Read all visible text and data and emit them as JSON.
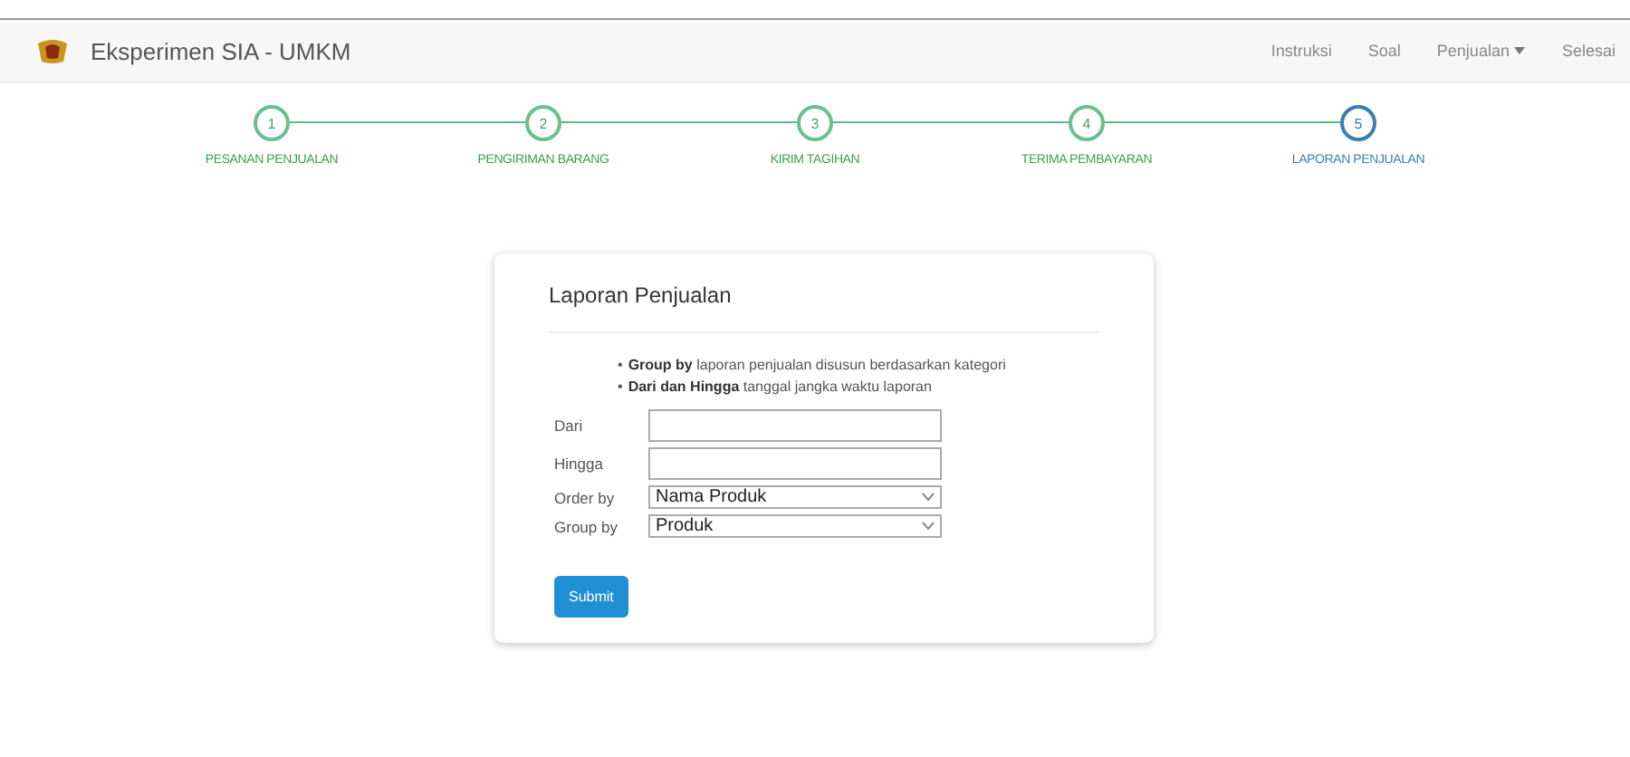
{
  "navbar": {
    "brand": "Eksperimen SIA - UMKM",
    "items": [
      {
        "label": "Instruksi",
        "kind": "link"
      },
      {
        "label": "Soal",
        "kind": "link"
      },
      {
        "label": "Penjualan",
        "kind": "dropdown"
      },
      {
        "label": "Selesai",
        "kind": "link"
      }
    ]
  },
  "steps": [
    {
      "number": "1",
      "label": "PESANAN PENJUALAN",
      "current": false
    },
    {
      "number": "2",
      "label": "PENGIRIMAN BARANG",
      "current": false
    },
    {
      "number": "3",
      "label": "KIRIM TAGIHAN",
      "current": false
    },
    {
      "number": "4",
      "label": "TERIMA PEMBAYARAN",
      "current": false
    },
    {
      "number": "5",
      "label": "LAPORAN PENJUALAN",
      "current": true
    }
  ],
  "card": {
    "title": "Laporan Penjualan",
    "notes": [
      {
        "bullet": "•",
        "text": "**Group by** laporan penjualan disusun berdasarkan kategori"
      },
      {
        "bullet": "•",
        "text": "**Dari dan Hingga** tanggal jangka waktu laporan"
      }
    ],
    "fields": [
      {
        "label": "Dari",
        "kind": "text"
      },
      {
        "label": "Hingga",
        "kind": "text"
      },
      {
        "label": "Order by",
        "kind": "select",
        "value": "Nama Produk"
      },
      {
        "label": "Group by",
        "kind": "select",
        "value": "Produk"
      }
    ],
    "submit": "Submit"
  }
}
